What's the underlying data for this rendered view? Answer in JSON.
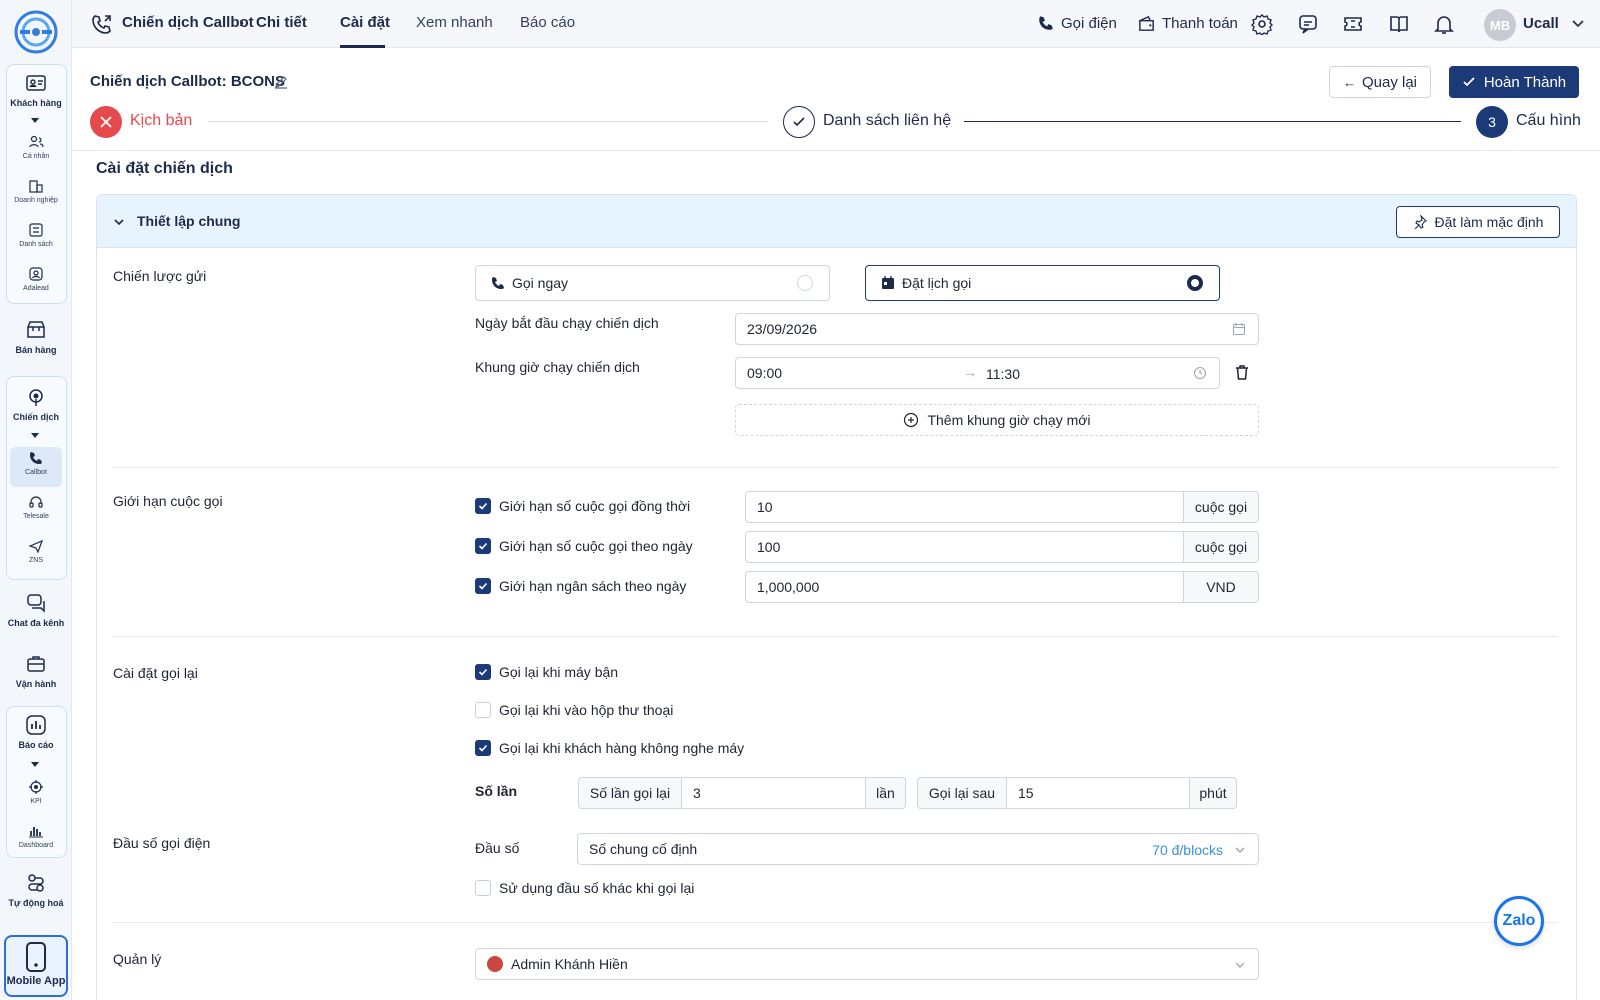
{
  "sidebar": {
    "khach_hang": "Khách hàng",
    "ca_nhan": "Cá nhân",
    "doanh_nghiep": "Doanh nghiệp",
    "danh_sach": "Danh sách",
    "adalead": "Adalead",
    "ban_hang": "Bán hàng",
    "chien_dich": "Chiến dịch",
    "callbot": "Callbot",
    "telesale": "Telesale",
    "zns": "ZNS",
    "chat_da_kenh": "Chat đa kênh",
    "van_hanh": "Vận hành",
    "bao_cao": "Báo cáo",
    "kpi": "KPI",
    "dashboard": "Dashboard",
    "tu_dong_hoa": "Tự động hoá",
    "mobile_app": "Mobile App"
  },
  "topbar": {
    "crumb_1": "Chiến dịch Callbot",
    "crumb_2": "Chi tiết",
    "tabs": [
      "Cài đặt",
      "Xem nhanh",
      "Báo cáo"
    ],
    "call": "Gọi điện",
    "payment": "Thanh toán",
    "avatar": "MB",
    "user": "Ucall"
  },
  "header": {
    "title": "Chiến dịch Callbot: BCONS",
    "back": "Quay lại",
    "done": "Hoàn Thành",
    "steps": [
      {
        "label": "Kịch bản"
      },
      {
        "label": "Danh sách liên hệ"
      },
      {
        "num": "3",
        "label": "Cấu hình"
      }
    ]
  },
  "section_title": "Cài đặt chiến dịch",
  "panel": {
    "title": "Thiết lập chung",
    "default_btn": "Đặt làm mặc định"
  },
  "strategy": {
    "label": "Chiến lược gửi",
    "call_now": "Gọi ngay",
    "schedule": "Đặt lịch gọi",
    "start_label": "Ngày bắt đầu chạy chiến dịch",
    "start_value": "23/09/2026",
    "window_label": "Khung giờ chạy chiến dịch",
    "time_from": "09:00",
    "time_to": "11:30",
    "add_window": "Thêm khung giờ chạy mới"
  },
  "limits": {
    "label": "Giới hạn cuộc gọi",
    "items": [
      {
        "label": "Giới hạn số cuộc gọi đồng thời",
        "value": "10",
        "unit": "cuộc gọi"
      },
      {
        "label": "Giới hạn số cuộc gọi theo ngày",
        "value": "100",
        "unit": "cuộc gọi"
      },
      {
        "label": "Giới hạn ngân sách theo ngày",
        "value": "1,000,000",
        "unit": "VND"
      }
    ]
  },
  "retry": {
    "label": "Cài đặt gọi lại",
    "busy": "Gọi lại khi máy bận",
    "voicemail": "Gọi lại khi vào hộp thư thoại",
    "no_answer": "Gọi lại khi khách hàng không nghe máy",
    "times_label": "Số lần",
    "count_label": "Số lần gọi lại",
    "count_value": "3",
    "count_unit": "lần",
    "after_label": "Gọi lại sau",
    "after_value": "15",
    "after_unit": "phút"
  },
  "caller": {
    "label": "Đầu số gọi điện",
    "field_label": "Đầu số",
    "value": "Số chung cố định",
    "price": "70 đ/blocks",
    "other": "Sử dụng đầu số khác khi gọi lại"
  },
  "manager": {
    "label": "Quản lý",
    "value": "Admin Khánh Hiền"
  },
  "zalo": "Zalo",
  "colors": {
    "primary": "#1d3a78",
    "danger": "#e5484d",
    "accent": "#1a74e8"
  }
}
